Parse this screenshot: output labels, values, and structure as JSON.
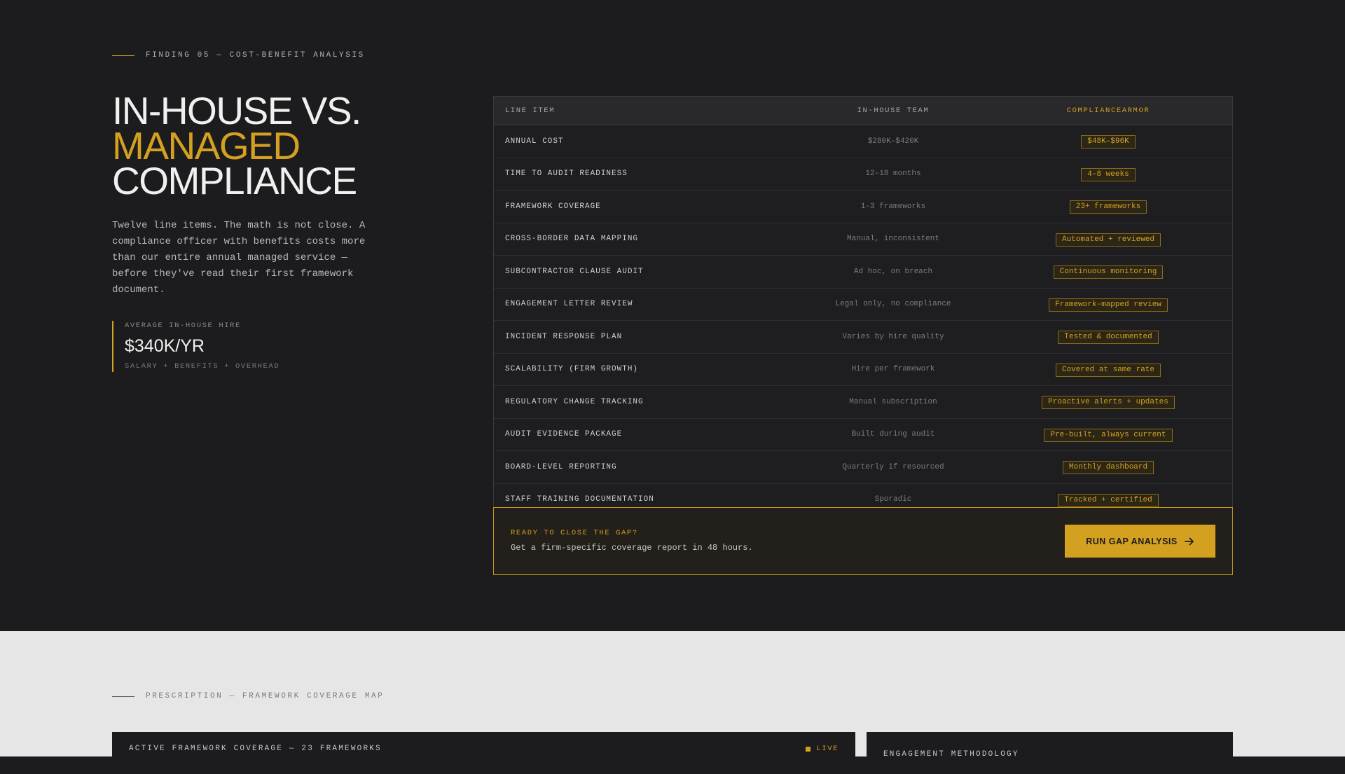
{
  "finding": {
    "eyebrow": "FINDING 05 — COST-BENEFIT ANALYSIS",
    "title_line1": "IN-HOUSE VS.",
    "title_line2": "MANAGED",
    "title_line3": "COMPLIANCE",
    "description": "Twelve line items. The math is not close. A compliance officer with benefits costs more than our entire annual managed service — before they've read their first framework document.",
    "stat": {
      "label": "AVERAGE IN-HOUSE HIRE",
      "value": "$340K/YR",
      "sub": "SALARY + BENEFITS + OVERHEAD"
    }
  },
  "comparison_table": {
    "headers": [
      "LINE ITEM",
      "IN-HOUSE TEAM",
      "COMPLIANCEARMOR"
    ],
    "rows": [
      {
        "item": "ANNUAL COST",
        "in_house": "$280K–$420K",
        "managed": "$48K–$96K"
      },
      {
        "item": "TIME TO AUDIT READINESS",
        "in_house": "12–18 months",
        "managed": "4–8 weeks"
      },
      {
        "item": "FRAMEWORK COVERAGE",
        "in_house": "1–3 frameworks",
        "managed": "23+ frameworks"
      },
      {
        "item": "CROSS-BORDER DATA MAPPING",
        "in_house": "Manual, inconsistent",
        "managed": "Automated + reviewed"
      },
      {
        "item": "SUBCONTRACTOR CLAUSE AUDIT",
        "in_house": "Ad hoc, on breach",
        "managed": "Continuous monitoring"
      },
      {
        "item": "ENGAGEMENT LETTER REVIEW",
        "in_house": "Legal only, no compliance",
        "managed": "Framework-mapped review"
      },
      {
        "item": "INCIDENT RESPONSE PLAN",
        "in_house": "Varies by hire quality",
        "managed": "Tested & documented"
      },
      {
        "item": "SCALABILITY (FIRM GROWTH)",
        "in_house": "Hire per framework",
        "managed": "Covered at same rate"
      },
      {
        "item": "REGULATORY CHANGE TRACKING",
        "in_house": "Manual subscription",
        "managed": "Proactive alerts + updates"
      },
      {
        "item": "AUDIT EVIDENCE PACKAGE",
        "in_house": "Built during audit",
        "managed": "Pre-built, always current"
      },
      {
        "item": "BOARD-LEVEL REPORTING",
        "in_house": "Quarterly if resourced",
        "managed": "Monthly dashboard"
      },
      {
        "item": "STAFF TRAINING DOCUMENTATION",
        "in_house": "Sporadic",
        "managed": "Tracked + certified"
      }
    ]
  },
  "cta": {
    "kicker": "READY TO CLOSE THE GAP?",
    "message": "Get a firm-specific coverage report in 48 hours.",
    "button_label": "RUN GAP ANALYSIS",
    "button_icon": "arrow-right-icon"
  },
  "prescription": {
    "eyebrow": "PRESCRIPTION — FRAMEWORK COVERAGE MAP",
    "coverage_panel_title": "ACTIVE FRAMEWORK COVERAGE — 23 FRAMEWORKS",
    "live_label": "LIVE",
    "methodology_panel_title": "ENGAGEMENT METHODOLOGY"
  },
  "colors": {
    "background_dark": "#1c1c1e",
    "background_light": "#e6e6e6",
    "accent": "#d4a020",
    "text_primary": "#f0f0f0",
    "text_muted": "#7c7c7c"
  }
}
